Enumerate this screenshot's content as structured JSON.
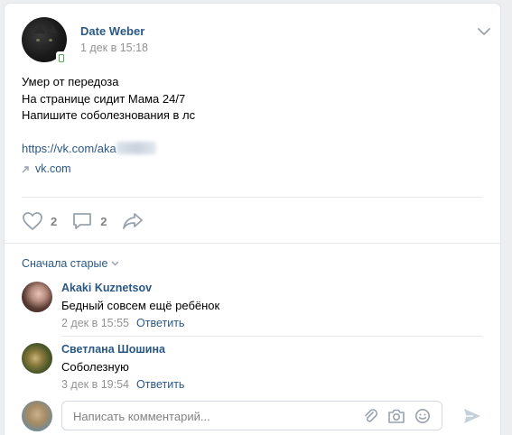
{
  "post": {
    "author": "Date Weber",
    "date": "1 дек в 15:18",
    "lines": [
      "Умер от передоза",
      "На странице сидит Мама 24/7",
      "Напишите соболезнования в лс"
    ],
    "link_text": "https://vk.com/aka",
    "source": "vk.com",
    "likes": "2",
    "comments": "2"
  },
  "comments_section": {
    "sort_label": "Сначала старые",
    "items": [
      {
        "name": "Akaki Kuznetsov",
        "text": "Бедный совсем ещё ребёнок",
        "date": "2 дек в 15:55",
        "reply": "Ответить"
      },
      {
        "name": "Светлана Шошина",
        "text": "Соболезную",
        "date": "3 дек в 19:54",
        "reply": "Ответить"
      }
    ]
  },
  "compose": {
    "placeholder": "Написать комментарий..."
  },
  "colors": {
    "link": "#2a5885",
    "muted": "#939393",
    "icon": "#828a99",
    "online": "#4bb34b"
  }
}
